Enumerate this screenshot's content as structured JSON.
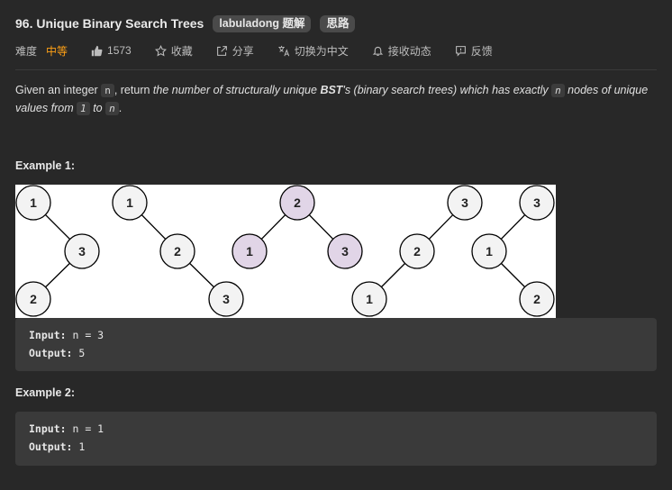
{
  "problem": {
    "title": "96. Unique Binary Search Trees",
    "tags": [
      "labuladong 题解",
      "思路"
    ]
  },
  "meta": {
    "difficulty_label": "难度",
    "difficulty": "中等",
    "likes": "1573",
    "favorite": "收藏",
    "share": "分享",
    "translate": "切换为中文",
    "notify": "接收动态",
    "feedback": "反馈"
  },
  "description": {
    "p1": "Given an integer ",
    "code_n": "n",
    "p2": ", return ",
    "p3": "the number of structurally unique ",
    "bst": "BST",
    "p4": "'s (binary search trees) which has exactly ",
    "p5": " nodes of unique values from ",
    "code_1": "1",
    "p6": " to ",
    "p7": "."
  },
  "example1": {
    "title": "Example 1:",
    "input_label": "Input:",
    "input_value": " n = 3",
    "output_label": "Output:",
    "output_value": " 5"
  },
  "example2": {
    "title": "Example 2:",
    "input_label": "Input:",
    "input_value": " n = 1",
    "output_label": "Output:",
    "output_value": " 1"
  },
  "trees": [
    {
      "nodes": [
        "1",
        "3",
        "2"
      ],
      "highlight": false
    },
    {
      "nodes": [
        "1",
        "2",
        "3"
      ],
      "highlight": false
    },
    {
      "nodes": [
        "2",
        "1",
        "3"
      ],
      "highlight": true
    },
    {
      "nodes": [
        "3",
        "2",
        "1"
      ],
      "highlight": false
    },
    {
      "nodes": [
        "3",
        "1",
        "2"
      ],
      "highlight": false
    }
  ],
  "colors": {
    "difficulty": "#ffa116",
    "node_fill": "#f3f3f3",
    "node_highlight": "#e1d5e7"
  }
}
